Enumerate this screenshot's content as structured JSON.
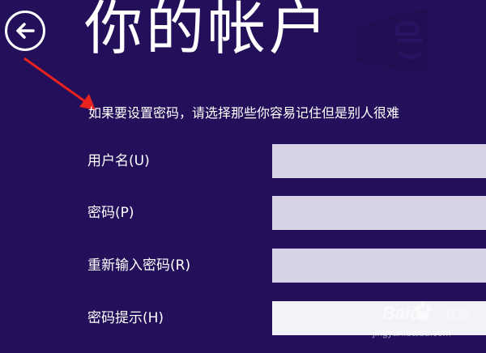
{
  "page": {
    "title": "你的帐户",
    "intro": "如果要设置密码，请选择那些你容易记住但是别人很难"
  },
  "form": {
    "fields": [
      {
        "label": "用户名(U)",
        "value": "",
        "placeholder": ""
      },
      {
        "label": "密码(P)",
        "value": "",
        "placeholder": ""
      },
      {
        "label": "重新输入密码(R)",
        "value": "",
        "placeholder": ""
      },
      {
        "label": "密码提示(H)",
        "value": "",
        "placeholder": ""
      }
    ]
  },
  "watermark": {
    "brand": "Baid",
    "brand_suffix": "经验",
    "url": "jingyan.baidu.com"
  },
  "icons": {
    "back": "back-arrow-icon",
    "annotation": "red-arrow-icon",
    "logo": "windows-store-logo-icon"
  },
  "colors": {
    "background": "#24105a",
    "input_fill": "#d7d2e6",
    "annotation": "#e8231f"
  }
}
